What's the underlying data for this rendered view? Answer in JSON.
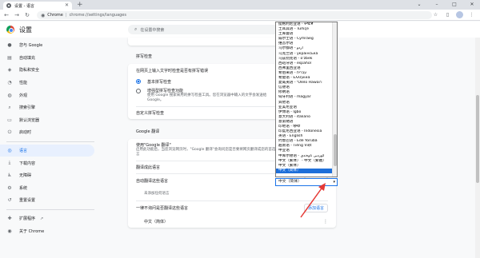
{
  "browser": {
    "tab_title": "设置 - 语言",
    "site_label": "Chrome",
    "url_path": "chrome://settings/languages",
    "new_tab": "+",
    "window_controls": [
      "⌄",
      "–",
      "□",
      "✕"
    ]
  },
  "app": {
    "title": "设置"
  },
  "search": {
    "placeholder": "在设置中搜索"
  },
  "sidebar": {
    "items": [
      {
        "label": "您与 Google",
        "icon": "person-icon"
      },
      {
        "label": "自动填充",
        "icon": "clipboard-icon"
      },
      {
        "label": "隐私和安全",
        "icon": "shield-icon"
      },
      {
        "label": "性能",
        "icon": "speed-icon"
      },
      {
        "label": "外观",
        "icon": "palette-icon"
      },
      {
        "label": "搜索引擎",
        "icon": "search-icon"
      },
      {
        "label": "默认浏览器",
        "icon": "browser-icon"
      },
      {
        "label": "启动时",
        "icon": "power-icon"
      },
      {
        "label": "语言",
        "icon": "globe-icon",
        "active": true
      },
      {
        "label": "下载内容",
        "icon": "download-icon"
      },
      {
        "label": "无障碍",
        "icon": "accessibility-icon"
      },
      {
        "label": "系统",
        "icon": "wrench-icon"
      },
      {
        "label": "重置设置",
        "icon": "reset-icon"
      }
    ],
    "extensions": "扩展程序",
    "about": "关于 Chrome"
  },
  "spellcheck": {
    "header": "拼写检查",
    "toggle_label": "在网页上输入文字时检查是否有拼写错误",
    "basic": "基本拼写检查",
    "enhanced": "增强型拼写检查功能",
    "enhanced_desc": "使用 Google 搜索采用的拼写检查工具。您在浏览器中输入的文字会发送给 Google。",
    "custom": "自定义拼写检查"
  },
  "translate": {
    "header": "Google 翻译",
    "use_label": "使用\"Google 翻译\"",
    "use_desc": "启用此功能后，当您浏览网页时，\"Google 翻译\"会询问您是否要将网页翻译成您的首选语言",
    "target_label": "翻译成此语言",
    "target_value": "中文（简体）",
    "auto_label": "自动翻译这些语言",
    "add_button": "添加语言",
    "auto_empty": "未添加任何语言",
    "never_label": "一律不询问是否翻译这些语言",
    "never_value": "中文（简体）"
  },
  "dropdown": {
    "options": [
      "提格利尼亚语 - ትግርኛ",
      "土耳其语 - Türkçe",
      "土库曼语",
      "威尔士语 - Cymraeg",
      "维吾尔语",
      "乌尔都语 - اردو",
      "乌克兰语 - українська",
      "乌兹别克语 - o'zbek",
      "西班牙语 - español",
      "西弗里西亚语",
      "希伯来语 - עברית",
      "希腊语 - Ελληνικά",
      "夏威夷语 - ʻŌlelo Hawaiʻi",
      "信德语",
      "修纳语",
      "匈牙利语 - magyar",
      "巽他语",
      "亚美尼亚语",
      "伊博语 - Igbo",
      "意大利语 - italiano",
      "意第绪语",
      "印地语 - हिन्दी",
      "印度尼西亚语 - Indonesia",
      "英语 - English",
      "约鲁巴语 - Èdè Yorùbá",
      "越南语 - Tiếng Việt",
      "中亚语",
      "中库尔德语 - کوردیی ناوەندی",
      "中文（繁体） - 中文（繁體）",
      "中文（繁体）",
      "中文（简体）"
    ],
    "selected_index": 30
  }
}
